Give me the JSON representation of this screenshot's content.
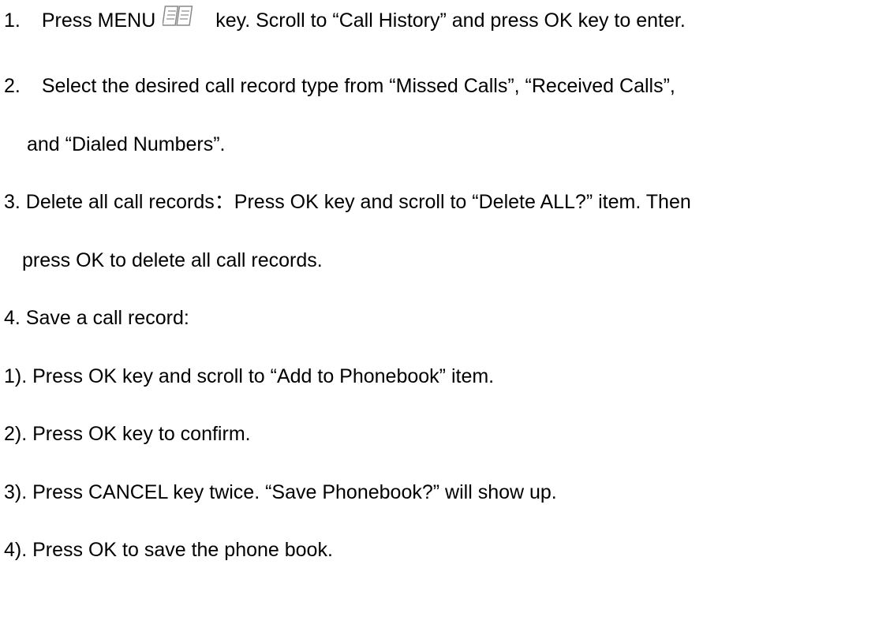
{
  "steps": {
    "s1_num": "1.",
    "s1_pre": "Press MENU",
    "s1_icon": "book-menu-icon",
    "s1_post": "key. Scroll to “Call History” and press OK key to enter.",
    "s2_num": "2.",
    "s2_line1": "Select the desired call record type from “Missed Calls”, “Received Calls”,",
    "s2_line2": "and “Dialed Numbers”.",
    "s3_line1": "3. Delete all call records：Press OK key and scroll to “Delete ALL?” item. Then",
    "s3_line2": "press OK to delete all call records.",
    "s4_title": "4. Save a call record:",
    "sub1": "1). Press OK key and scroll to “Add to Phonebook” item.",
    "sub2": "2). Press OK key to confirm.",
    "sub3": "3). Press CANCEL key twice. “Save Phonebook?” will show up.",
    "sub4": "4). Press OK to save the phone book."
  }
}
